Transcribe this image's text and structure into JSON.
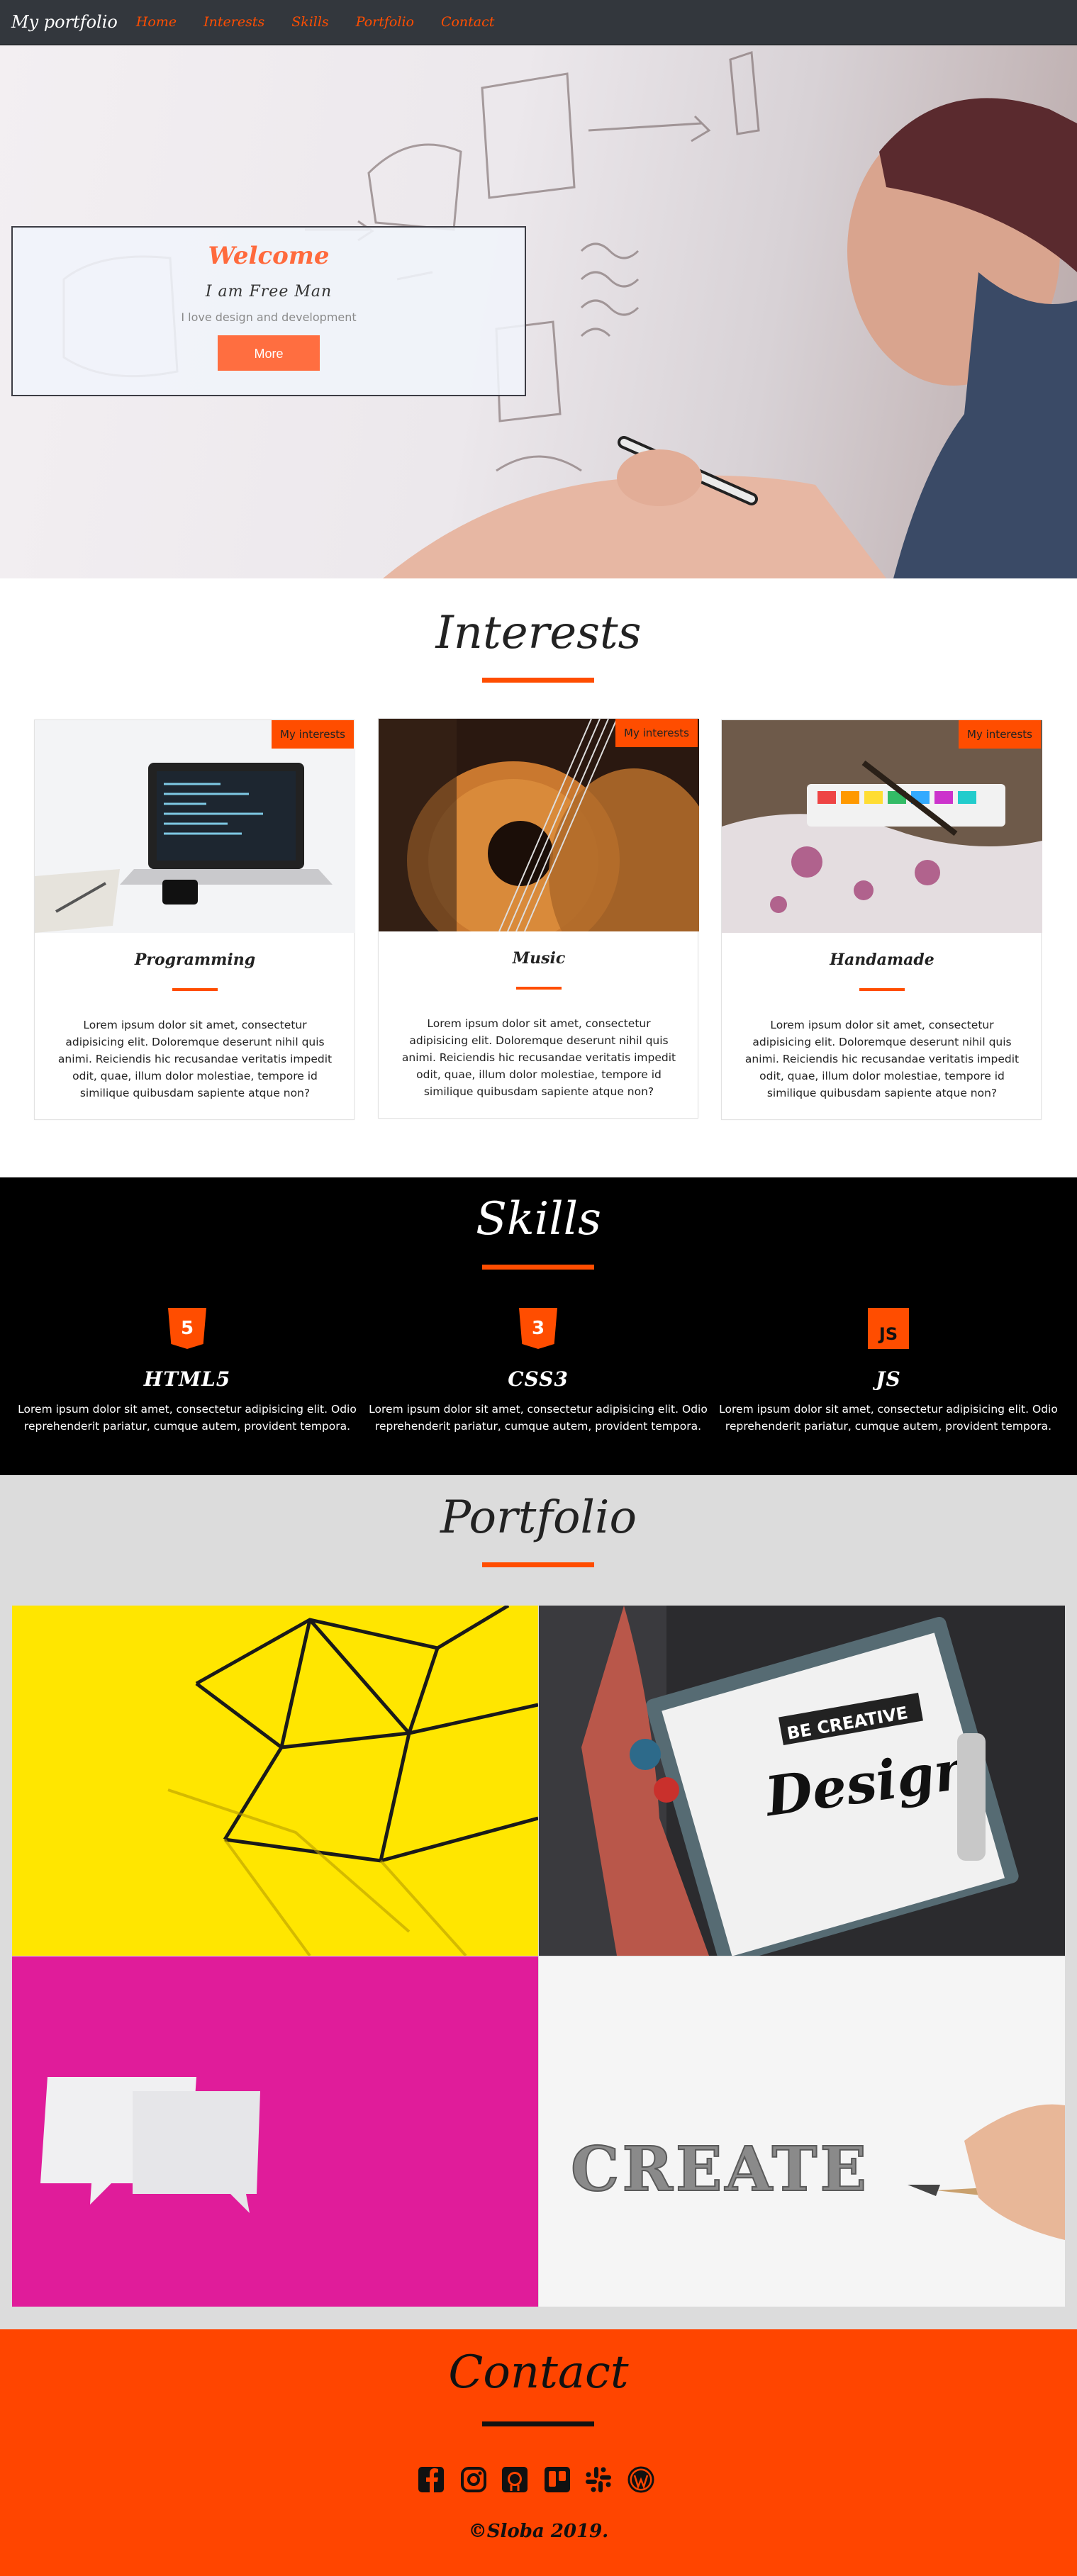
{
  "nav": {
    "brand": "My portfolio",
    "links": [
      "Home",
      "Interests",
      "Skills",
      "Portfolio",
      "Contact"
    ]
  },
  "hero": {
    "title": "Welcome",
    "subtitle": "I am Free Man",
    "description": "I love design and development",
    "button": "More"
  },
  "interests": {
    "title": "Interests",
    "cards": [
      {
        "badge": "My interests",
        "title": "Programming",
        "text": "Lorem ipsum dolor sit amet, consectetur adipisicing elit. Doloremque deserunt nihil quis animi. Reiciendis hic recusandae veritatis impedit odit, quae, illum dolor molestiae, tempore id similique quibusdam sapiente atque non?"
      },
      {
        "badge": "My interests",
        "title": "Music",
        "text": "Lorem ipsum dolor sit amet, consectetur adipisicing elit. Doloremque deserunt nihil quis animi. Reiciendis hic recusandae veritatis impedit odit, quae, illum dolor molestiae, tempore id similique quibusdam sapiente atque non?"
      },
      {
        "badge": "My interests",
        "title": "Handamade",
        "text": "Lorem ipsum dolor sit amet, consectetur adipisicing elit. Doloremque deserunt nihil quis animi. Reiciendis hic recusandae veritatis impedit odit, quae, illum dolor molestiae, tempore id similique quibusdam sapiente atque non?"
      }
    ]
  },
  "skills": {
    "title": "Skills",
    "items": [
      {
        "icon": "html5-icon",
        "glyph": "5",
        "name": "HTML5",
        "text": "Lorem ipsum dolor sit amet, consectetur adipisicing elit. Odio reprehenderit pariatur, cumque autem, provident tempora."
      },
      {
        "icon": "css3-icon",
        "glyph": "3",
        "name": "CSS3",
        "text": "Lorem ipsum dolor sit amet, consectetur adipisicing elit. Odio reprehenderit pariatur, cumque autem, provident tempora."
      },
      {
        "icon": "js-icon",
        "glyph": "JS",
        "name": "JS",
        "text": "Lorem ipsum dolor sit amet, consectetur adipisicing elit. Odio reprehenderit pariatur, cumque autem, provident tempora."
      }
    ]
  },
  "portfolio": {
    "title": "Portfolio",
    "tiles": [
      {
        "kind": "yellow-wire-geometric"
      },
      {
        "kind": "design-clipboard",
        "badge_text": "BE CREATIVE",
        "script_text": "Design"
      },
      {
        "kind": "pink-speech-bubbles"
      },
      {
        "kind": "create-pencil",
        "word": "CREATE"
      }
    ]
  },
  "contact": {
    "title": "Contact",
    "icons": [
      "facebook-icon",
      "instagram-icon",
      "github-icon",
      "trello-icon",
      "slack-icon",
      "wordpress-icon"
    ],
    "footer": "©Sloba 2019."
  },
  "colors": {
    "accent": "#ff4d00",
    "navbar": "#33373d",
    "skills_bg": "#000000",
    "portfolio_bg": "#dcdcdc",
    "contact_bg": "#ff4500"
  }
}
